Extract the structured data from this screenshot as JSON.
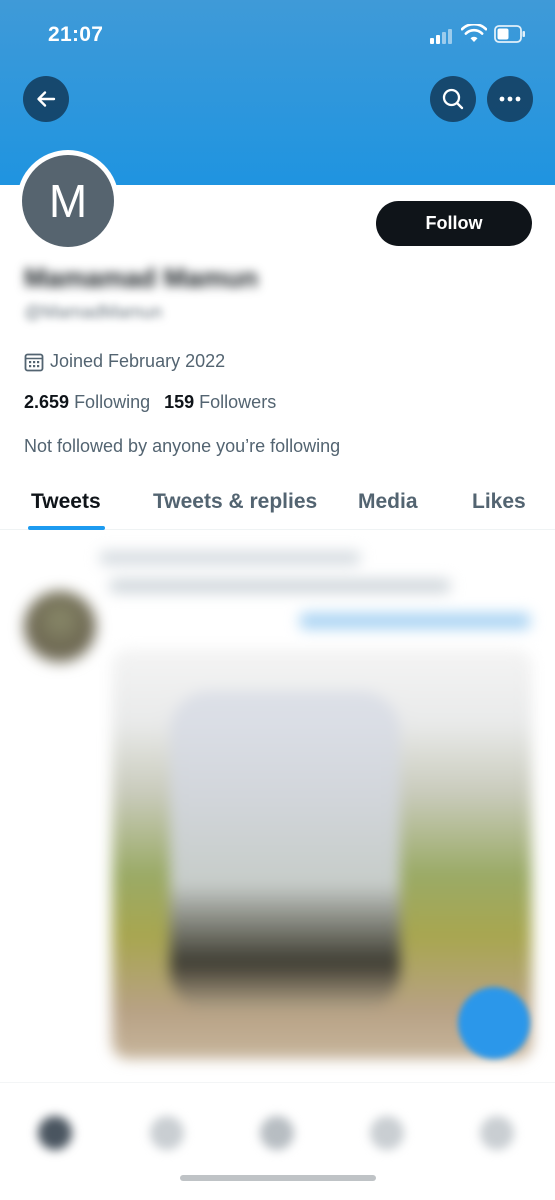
{
  "status_bar": {
    "time": "21:07"
  },
  "profile": {
    "avatar_initial": "M",
    "display_name": "Mamamad Mamun",
    "handle": "@MamadMamun",
    "joined": "Joined February 2022",
    "following_count": "2.659",
    "following_label": "Following",
    "followers_count": "159",
    "followers_label": "Followers",
    "not_followed_text": "Not followed by anyone you’re following"
  },
  "actions": {
    "follow_label": "Follow"
  },
  "tabs": [
    {
      "label": "Tweets",
      "active": true
    },
    {
      "label": "Tweets & replies",
      "active": false
    },
    {
      "label": "Media",
      "active": false
    },
    {
      "label": "Likes",
      "active": false
    }
  ],
  "colors": {
    "banner": "#1f94e0",
    "accent": "#1d9bf0",
    "follow_button": "#0f1419",
    "avatar_bg": "#56646f"
  },
  "icons": [
    "back-arrow-icon",
    "search-icon",
    "more-dots-icon",
    "calendar-icon",
    "compose-icon"
  ]
}
